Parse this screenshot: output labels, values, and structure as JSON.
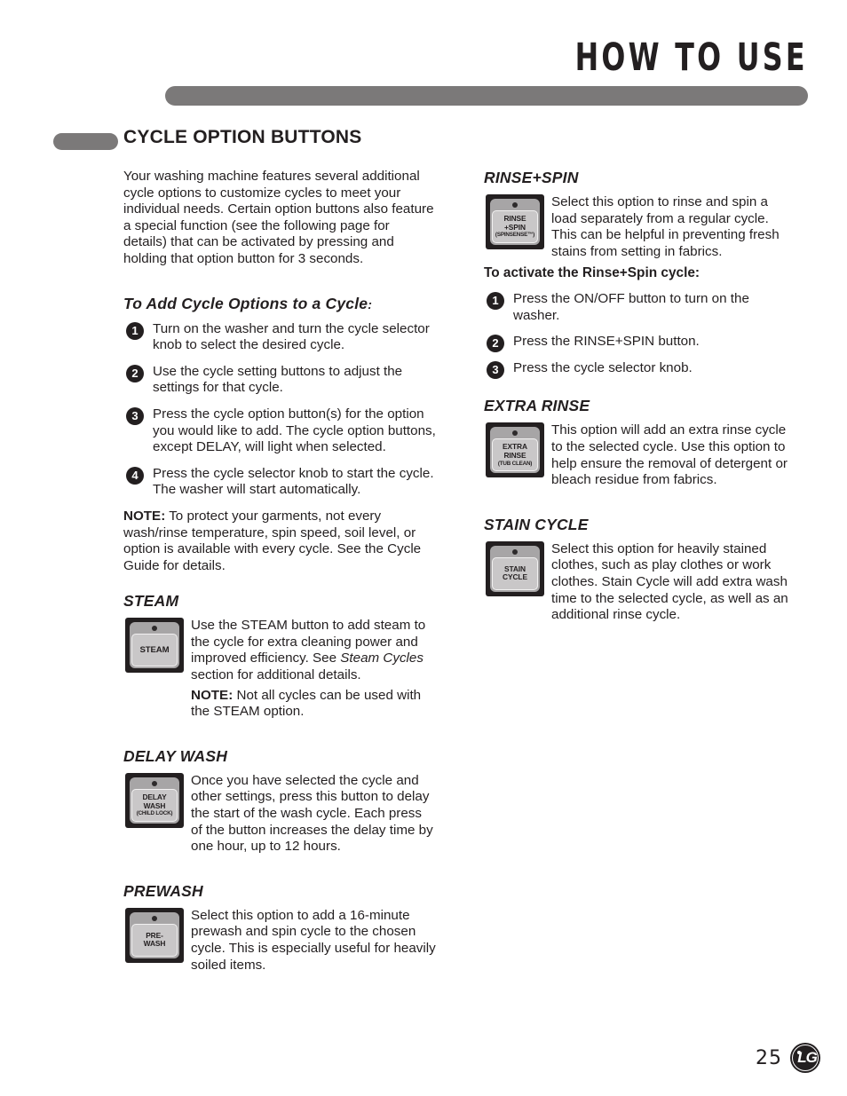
{
  "header": {
    "title": "HOW TO USE",
    "bar_color": "#7b7979"
  },
  "section": {
    "title": "CYCLE OPTION BUTTONS",
    "bullet_color": "#7b7979"
  },
  "left_column": {
    "intro": "Your washing machine features several additional cycle options to customize cycles to meet your individual needs. Certain option buttons also feature a special function (see the following page for details) that can be activated by pressing and holding that option button for 3 seconds.",
    "add_options_heading": "To Add Cycle Options to a Cycle",
    "add_options_heading_colon": ":",
    "steps": [
      {
        "num": "1",
        "text": "Turn on the washer and turn the cycle selector knob to select the desired cycle."
      },
      {
        "num": "2",
        "text": "Use the cycle setting buttons to adjust the settings for that cycle."
      },
      {
        "num": "3",
        "text": "Press the cycle option button(s) for the option you would like to add. The cycle option buttons, except DELAY, will light when selected."
      },
      {
        "num": "4",
        "text": "Press the cycle selector knob to start the cycle. The washer will start automatically."
      }
    ],
    "note_label": "NOTE:",
    "note_text": " To protect your garments, not every wash/rinse temperature, spin speed, soil level, or option is available with every cycle. See the Cycle Guide for details.",
    "steam": {
      "heading": "STEAM",
      "button_lines": [
        "STEAM"
      ],
      "text_a": "Use the STEAM button to add steam to the cycle for extra cleaning power and improved efficiency. See ",
      "text_italic": "Steam Cycles",
      "text_b": " section for additional details.",
      "note_label": "NOTE:",
      "note_text": " Not all cycles can be used with the STEAM option."
    },
    "delay_wash": {
      "heading": "DELAY WASH",
      "button_lines": [
        "DELAY",
        "WASH",
        "(CHILD LOCK)"
      ],
      "text": "Once you have selected the cycle and other settings, press this button to delay the start of the wash cycle. Each press of the button increases the delay time by one hour, up to 12 hours."
    },
    "prewash": {
      "heading": "PREWASH",
      "button_lines": [
        "PRE-",
        "WASH"
      ],
      "text": "Select this option to add a 16-minute prewash and spin cycle to the chosen cycle. This is especially useful for heavily soiled items."
    }
  },
  "right_column": {
    "rinse_spin": {
      "heading": "RINSE+SPIN",
      "button_lines": [
        "RINSE",
        "+SPIN",
        "(SPINSENSE™)"
      ],
      "text": "Select this option to rinse and spin a load separately from a regular cycle. This can be helpful in preventing fresh stains from setting in fabrics.",
      "activate_heading": "To activate the Rinse+Spin cycle:",
      "steps": [
        {
          "num": "1",
          "text": "Press the ON/OFF button to turn on the washer."
        },
        {
          "num": "2",
          "text": "Press the RINSE+SPIN button."
        },
        {
          "num": "3",
          "text": "Press the cycle selector knob."
        }
      ]
    },
    "extra_rinse": {
      "heading": "EXTRA RINSE",
      "button_lines": [
        "EXTRA",
        "RINSE",
        "(TUB CLEAN)"
      ],
      "text": "This option will add an extra rinse cycle to the selected cycle. Use this option to help ensure the removal of detergent or bleach residue from fabrics."
    },
    "stain_cycle": {
      "heading": "STAIN CYCLE",
      "button_lines": [
        "STAIN",
        "CYCLE"
      ],
      "text": "Select this option for heavily stained clothes, such as play clothes or work clothes. Stain Cycle will add extra wash time to the selected cycle, as well as an additional rinse cycle."
    }
  },
  "footer": {
    "page_number": "25",
    "brand": "LG"
  }
}
